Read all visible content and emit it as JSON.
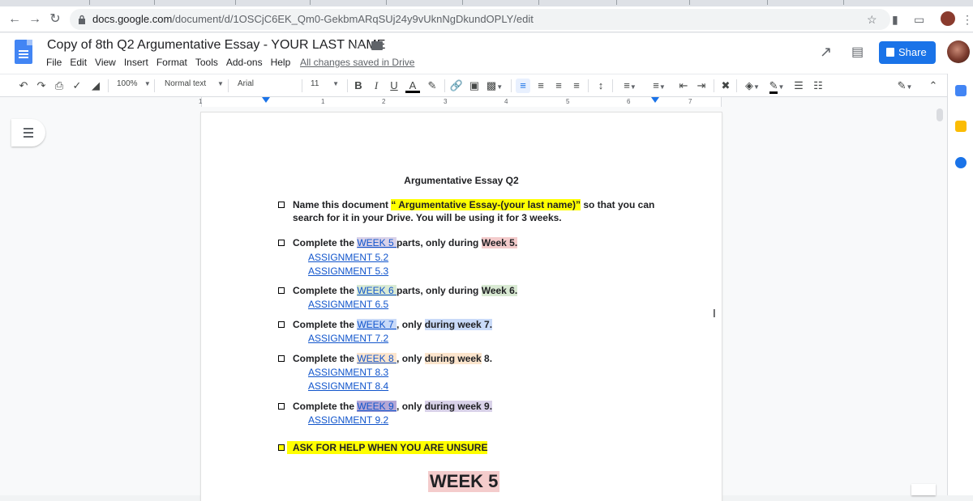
{
  "browser": {
    "url_host": "docs.google.com",
    "url_path": "/document/d/1OSCjC6EK_Qm0-GekbmARqSUj24y9vUknNgDkundOPLY/edit"
  },
  "docs": {
    "title": "Copy of 8th Q2 Argumentative Essay - YOUR LAST NAME",
    "menu": [
      "File",
      "Edit",
      "View",
      "Insert",
      "Format",
      "Tools",
      "Add-ons",
      "Help"
    ],
    "save_status": "All changes saved in Drive",
    "share_label": "Share"
  },
  "toolbar": {
    "zoom": "100%",
    "style": "Normal text",
    "font": "Arial",
    "font_size": "11",
    "ruler_numbers": [
      "1",
      "1",
      "2",
      "3",
      "4",
      "5",
      "6",
      "7"
    ]
  },
  "document": {
    "heading": "Argumentative Essay Q2",
    "intro": {
      "prefix": "Name this document ",
      "highlight": "“ Argumentative Essay-(your last name)”",
      "suffix": " so that you can",
      "line2": "search for it in your Drive. You will be using it for 3 weeks."
    },
    "items": [
      {
        "pre": "Complete the ",
        "link": "WEEK 5 ",
        "mid": "parts, only during ",
        "tag": "Week 5.",
        "subs": [
          "ASSIGNMENT 5.2",
          "ASSIGNMENT 5.3"
        ]
      },
      {
        "pre": "Complete the ",
        "link": "WEEK 6 ",
        "mid": "parts, only during ",
        "tag": "Week 6.",
        "subs": [
          "ASSIGNMENT 6.5"
        ]
      },
      {
        "pre": "Complete the ",
        "link": "WEEK 7 ",
        "mid": ", only ",
        "tag": "during week 7.",
        "subs": [
          "ASSIGNMENT 7.2"
        ]
      },
      {
        "pre": "Complete the ",
        "link": "WEEK 8 ",
        "mid": ", only ",
        "tag": "during week",
        "tail": " 8.",
        "subs": [
          "ASSIGNMENT 8.3",
          "ASSIGNMENT 8.4"
        ]
      },
      {
        "pre": "Complete the ",
        "link": "WEEK 9 ",
        "mid": ", only ",
        "tag": "during week 9.",
        "subs": [
          "ASSIGNMENT 9.2"
        ]
      }
    ],
    "help_note": "ASK FOR HELP WHEN YOU ARE UNSURE",
    "section_title": "WEEK 5"
  },
  "colors": {
    "share_button": "#1a73e8",
    "link": "#1155cc",
    "highlight_yellow": "#ffff00",
    "highlight_pink": "#f4cccc",
    "highlight_green": "#d9ead3",
    "highlight_blue": "#c9daf8",
    "highlight_peach": "#fce5cd"
  }
}
